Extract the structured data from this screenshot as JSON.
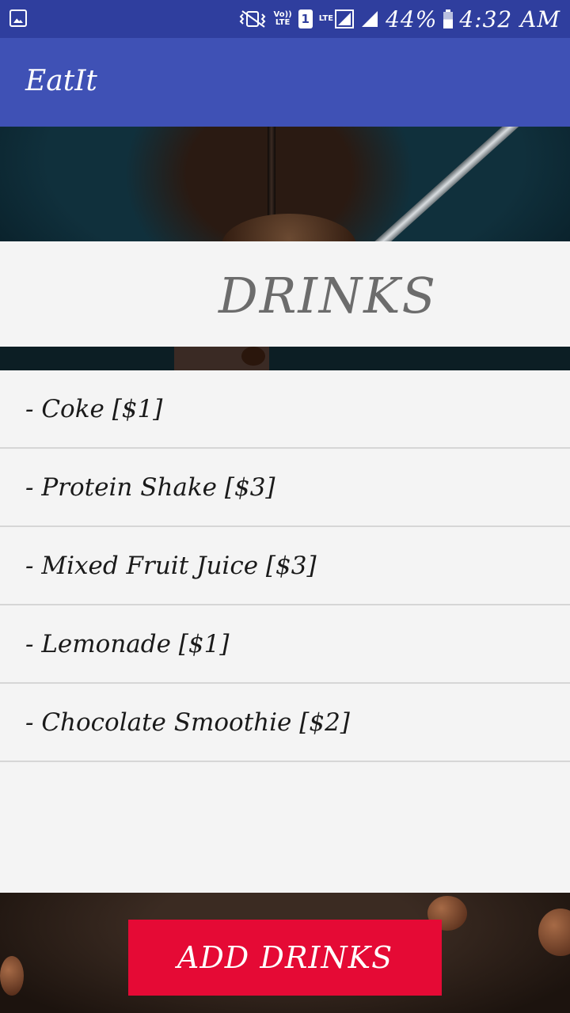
{
  "status_bar": {
    "network_label_top": "Vo))",
    "network_label_bottom": "LTE",
    "sim_slot": "1",
    "lte_label": "LTE",
    "battery": "44%",
    "time": "4:32 AM",
    "icons": [
      "gallery-notification-icon",
      "vibrate-icon",
      "volte-icon",
      "sim-icon",
      "signal-icon",
      "battery-icon"
    ]
  },
  "app": {
    "title": "EatIt"
  },
  "header": {
    "title": "DRINKS"
  },
  "menu": {
    "items": [
      "- Coke [$1]",
      "- Protein Shake [$3]",
      "- Mixed Fruit Juice [$3]",
      "- Lemonade [$1]",
      "- Chocolate Smoothie [$2]"
    ]
  },
  "actions": {
    "add_label": "ADD DRINKS"
  },
  "colors": {
    "appbar": "#3f51b5",
    "statusbar": "#2f3e9e",
    "button": "#e50a35",
    "list_bg": "#f4f4f4"
  }
}
